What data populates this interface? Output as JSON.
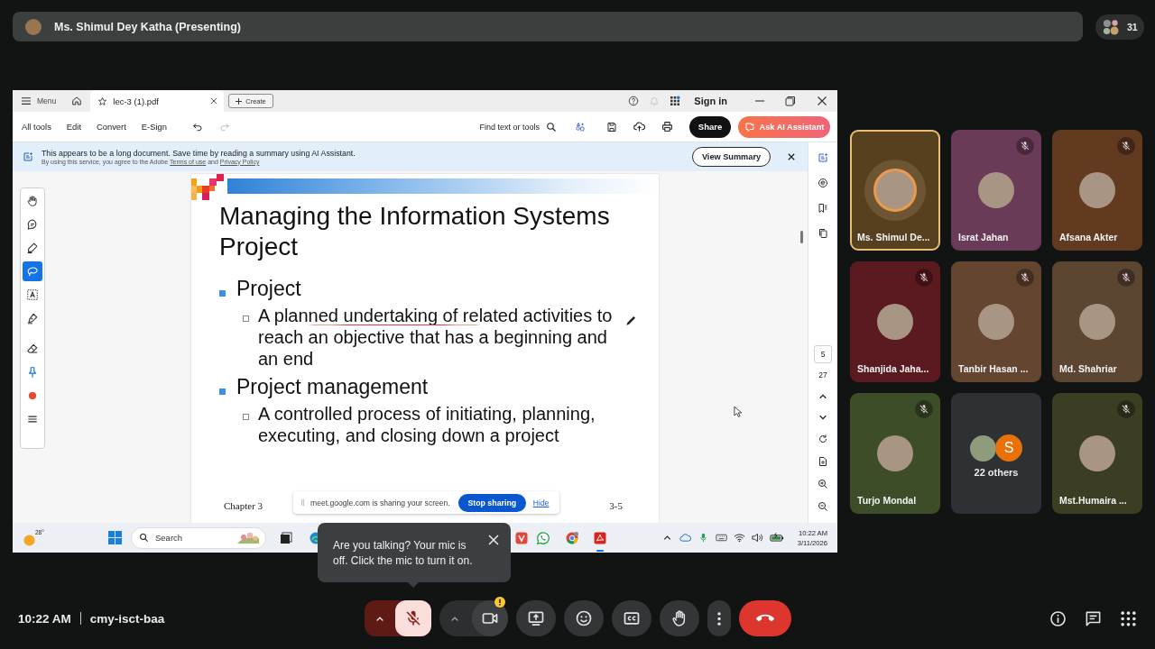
{
  "presenter_bar": {
    "name": "Ms. Shimul Dey Katha (Presenting)",
    "participant_count": "31"
  },
  "acrobat": {
    "title_bar": {
      "menu_label": "Menu",
      "tabs": [
        {
          "label": "lec-3 (1).pdf",
          "selected": true
        }
      ],
      "create_label": "Create",
      "sign_in_label": "Sign in"
    },
    "toolbar": {
      "menu_items": [
        "All tools",
        "Edit",
        "Convert",
        "E-Sign"
      ],
      "undo_disabled": false,
      "redo_disabled": true,
      "search_label": "Find text or tools",
      "share_label": "Share",
      "ai_label": "Ask AI Assistant"
    },
    "banner": {
      "message": "This appears to be a long document. Save time by reading a summary using AI Assistant.",
      "legal": [
        {
          "kind": "text",
          "text": "By using this service, you agree to the Adobe"
        },
        {
          "kind": "link",
          "text": "Terms of use"
        },
        {
          "kind": "text",
          "text": "and"
        },
        {
          "kind": "link",
          "text": "Privacy Policy"
        }
      ],
      "button_label": "View Summary"
    },
    "tools": [
      {
        "selected": false
      },
      {
        "selected": false
      },
      {
        "selected": false
      },
      {
        "selected": true
      },
      {
        "selected": false
      },
      {
        "selected": false
      },
      {
        "selected": false
      },
      {
        "selected": false
      },
      {
        "selected": false
      },
      {
        "selected": false
      }
    ],
    "slide": {
      "title": "Managing the Information Systems Project",
      "bullets": [
        {
          "text": "Project",
          "children": [
            {
              "text": "A planned undertaking of related activities to reach an objective that has a beginning and an end"
            }
          ]
        },
        {
          "text": "Project management",
          "children": [
            {
              "text": "A controlled process of initiating, planning, executing, and closing down a project"
            }
          ]
        }
      ],
      "footer_left": "Chapter 3",
      "footer_right": "3-5"
    },
    "share_notice": {
      "message": "meet.google.com is sharing your screen.",
      "stop_label": "Stop sharing",
      "hide_label": "Hide"
    },
    "page_nav": {
      "current_page": "5",
      "total_pages": "27"
    }
  },
  "taskbar": {
    "weather_temp": "28°",
    "search_label": "Search",
    "apps": [
      {
        "active": false
      },
      {
        "active": false
      },
      {
        "active": false
      },
      {
        "active": false
      },
      {
        "active": false
      },
      {
        "active": true
      }
    ],
    "time": "10:22 AM",
    "date": "3/11/2026"
  },
  "participants": [
    {
      "kind": "person",
      "name": "Ms. Shimul De...",
      "muted": false,
      "active_speaker": true,
      "color": "#56401f"
    },
    {
      "kind": "person",
      "name": "Israt Jahan",
      "muted": true,
      "active_speaker": false,
      "color": "#6a3b56"
    },
    {
      "kind": "person",
      "name": "Afsana Akter",
      "muted": true,
      "active_speaker": false,
      "color": "#613a20"
    },
    {
      "kind": "person",
      "name": "Shanjida Jaha...",
      "muted": true,
      "active_speaker": false,
      "color": "#5a1a1f"
    },
    {
      "kind": "person",
      "name": "Tanbir Hasan ...",
      "muted": true,
      "active_speaker": false,
      "color": "#634530"
    },
    {
      "kind": "person",
      "name": "Md. Shahriar",
      "muted": true,
      "active_speaker": false,
      "color": "#5c4531"
    },
    {
      "kind": "person",
      "name": "Turjo Mondal",
      "muted": true,
      "active_speaker": false,
      "color": "#3c4d27"
    },
    {
      "kind": "others",
      "label": "22 others",
      "initial": "S",
      "muted": false,
      "active_speaker": false,
      "color": "#2e3133"
    },
    {
      "kind": "person",
      "name": "Mst.Humaira ...",
      "muted": true,
      "active_speaker": false,
      "color": "#3b3e22"
    }
  ],
  "mic_tooltip": {
    "message": "Are you talking? Your mic is off. Click the mic to turn it on."
  },
  "meeting_bar": {
    "time": "10:22 AM",
    "meeting_code": "cmy-isct-baa",
    "mic_on": false,
    "camera_on": true,
    "camera_warning": true
  }
}
